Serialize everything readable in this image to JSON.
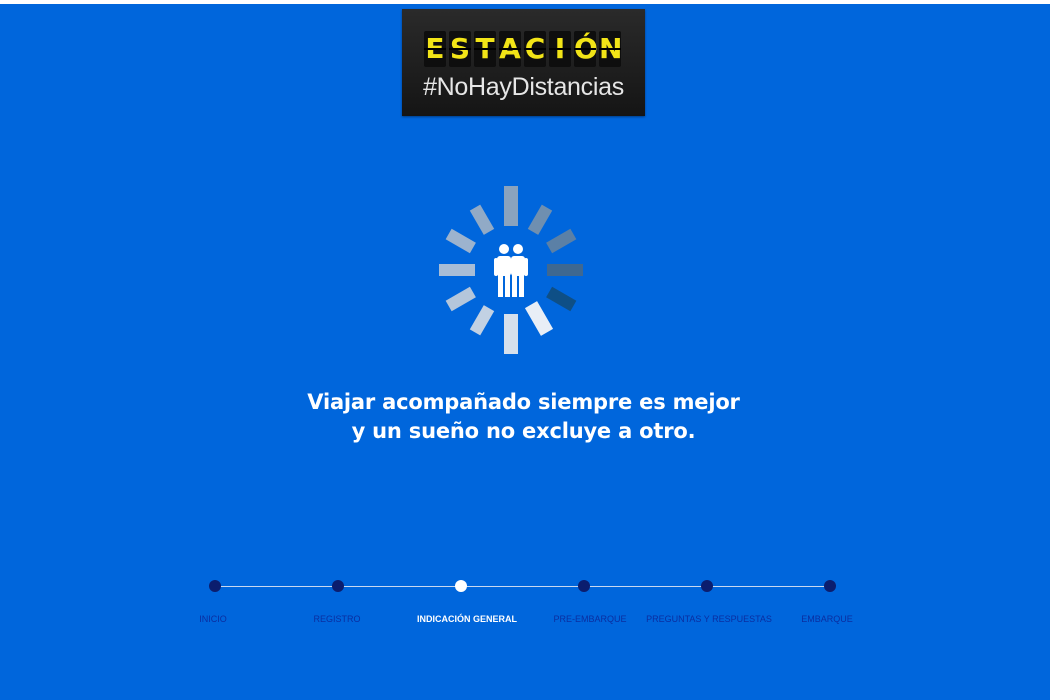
{
  "logo": {
    "title_chars": [
      "E",
      "S",
      "T",
      "A",
      "C",
      "I",
      "Ó",
      "N"
    ],
    "subtitle": "#NoHayDistancias"
  },
  "spinner": {
    "icon": "couple-icon"
  },
  "message": {
    "line1": "Viajar acompañado siempre es mejor",
    "line2": "y un sueño no excluye a otro."
  },
  "progress": {
    "steps": [
      {
        "label": "INICIO",
        "active": false
      },
      {
        "label": "REGISTRO",
        "active": false
      },
      {
        "label": "INDICACIÓN GENERAL",
        "active": true
      },
      {
        "label": "PRE-EMBARQUE",
        "active": false
      },
      {
        "label": "PREGUNTAS Y RESPUESTAS",
        "active": false
      },
      {
        "label": "EMBARQUE",
        "active": false
      }
    ]
  },
  "colors": {
    "background": "#0066dc",
    "logo_text": "#f2e417",
    "step_inactive": "#0b1d6e",
    "step_active": "#ffffff"
  }
}
